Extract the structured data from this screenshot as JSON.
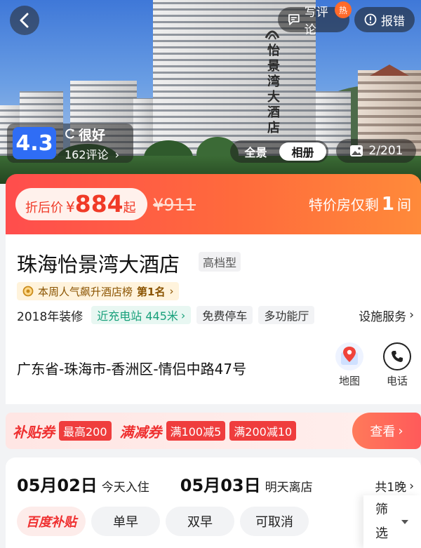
{
  "header": {
    "write_review": "写评论",
    "hot_badge": "热",
    "report_error": "报错",
    "building_sign": "怡景湾大酒店"
  },
  "rating": {
    "score": "4.3",
    "grade": "很好",
    "review_count": "162评论"
  },
  "gallery": {
    "tabs": [
      "全景",
      "相册"
    ],
    "active_tab": "相册",
    "photo_count": "2/201"
  },
  "price": {
    "label": "折后价",
    "currency": "¥",
    "value": "884",
    "suffix": "起",
    "original": "¥911",
    "special_text": "特价房仅剩",
    "special_count": "1",
    "special_unit": "间"
  },
  "hotel": {
    "name": "珠海怡景湾大酒店",
    "class": "高档型",
    "rank_text": "本周人气飙升酒店榜",
    "rank_value": "第1名",
    "renovated": "2018年装修",
    "charging": "近充电站 445米",
    "tags": [
      "免费停车",
      "多功能厅"
    ],
    "facilities_link": "设施服务",
    "address": "广东省-珠海市-香洲区-情侣中路47号",
    "map_label": "地图",
    "phone_label": "电话"
  },
  "coupons": {
    "subsidy_title": "补贴券",
    "subsidy_max": "最高200",
    "discount_title": "满减券",
    "chips": [
      "满100减5",
      "满200减10"
    ],
    "view_label": "查看"
  },
  "booking": {
    "checkin_date": "05月02日",
    "checkin_label": "今天入住",
    "checkout_date": "05月03日",
    "checkout_label": "明天离店",
    "nights": "共1晚",
    "filters": [
      "百度补贴",
      "单早",
      "双早",
      "可取消"
    ],
    "filter_button": "筛选"
  },
  "colors": {
    "score_blue": "#2f6df5",
    "price_red": "#f03a27",
    "charge_green": "#17a07a",
    "coupon_red": "#ef3d3d"
  }
}
